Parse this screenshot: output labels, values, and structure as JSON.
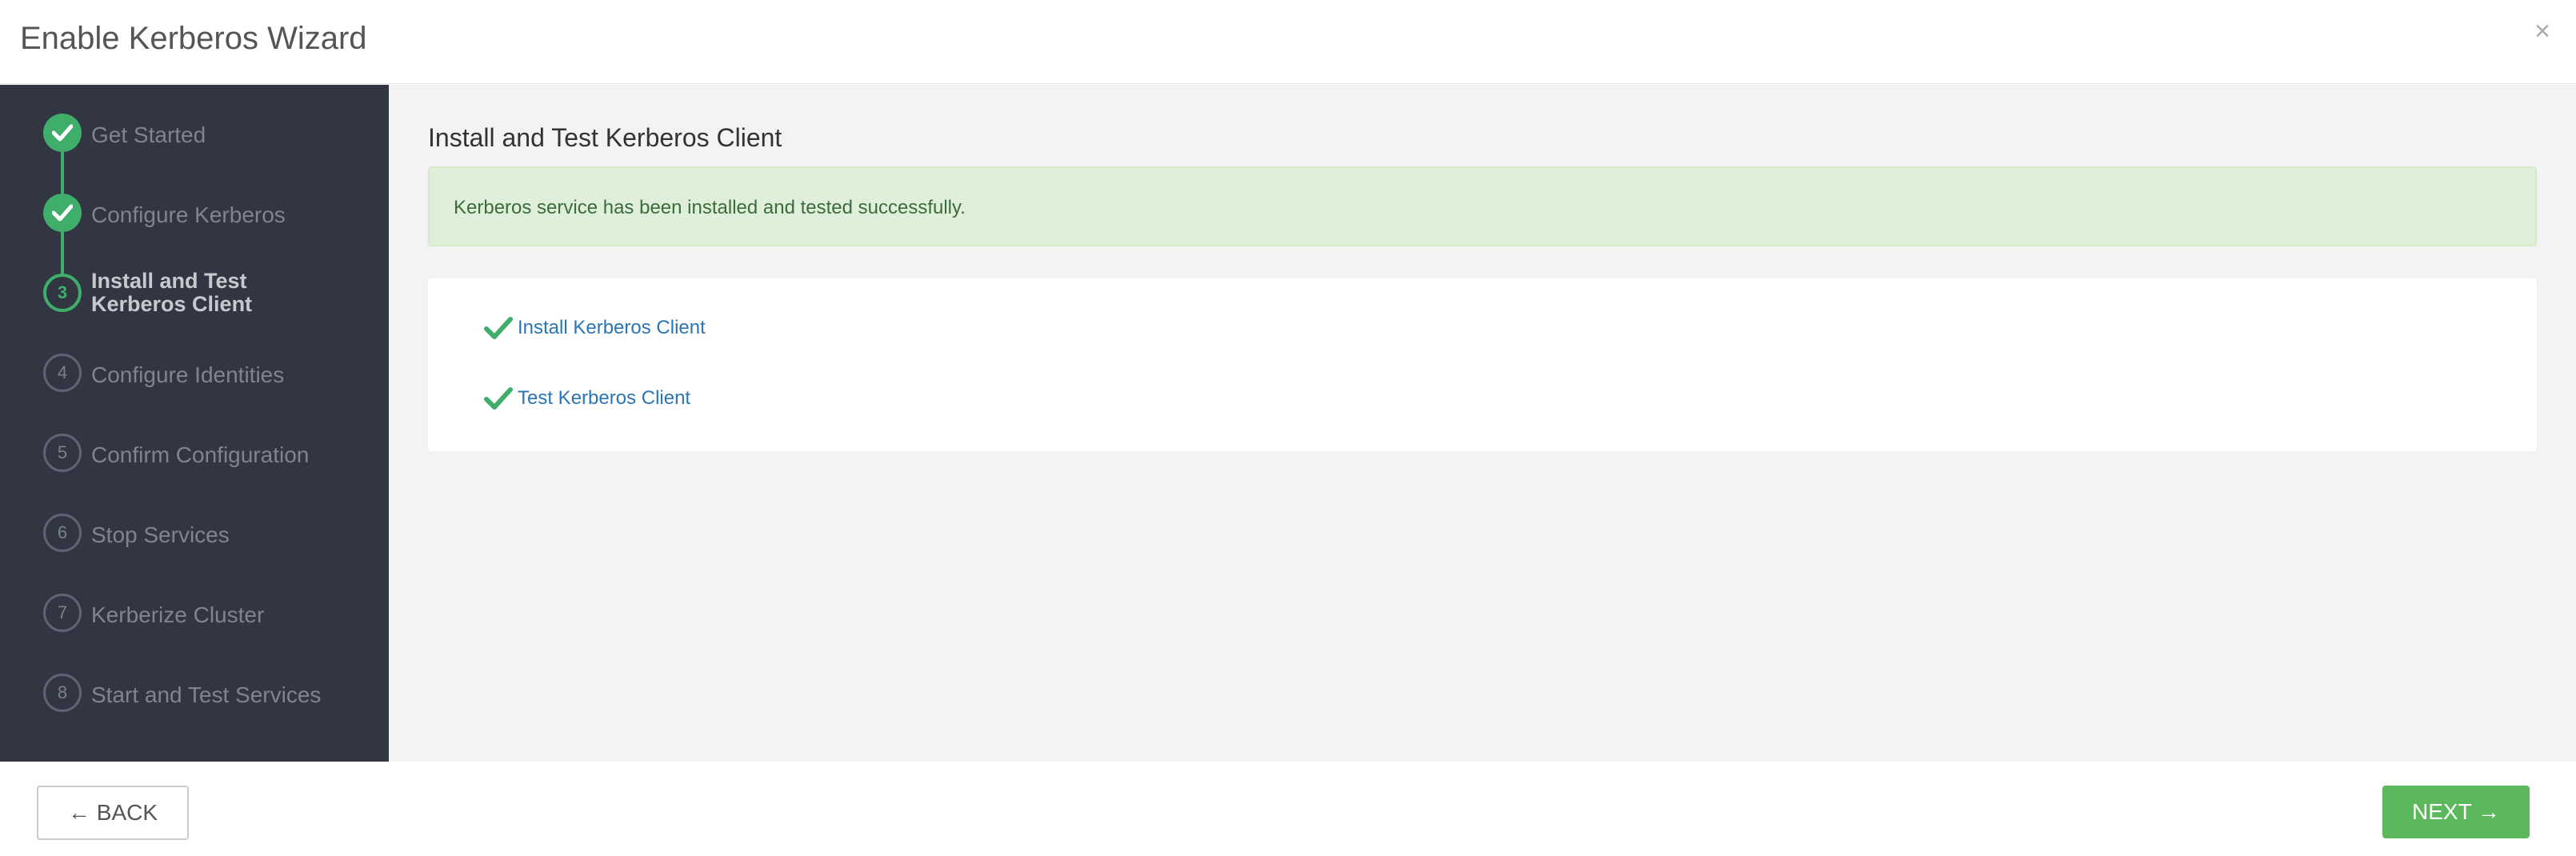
{
  "header": {
    "title": "Enable Kerberos Wizard",
    "close_label": "×"
  },
  "sidebar": {
    "steps": [
      {
        "number": "1",
        "label": "Get Started",
        "state": "done"
      },
      {
        "number": "2",
        "label": "Configure Kerberos",
        "state": "done"
      },
      {
        "number": "3",
        "label_line1": "Install and Test",
        "label_line2": "Kerberos Client",
        "state": "current"
      },
      {
        "number": "4",
        "label": "Configure Identities",
        "state": "todo"
      },
      {
        "number": "5",
        "label": "Confirm Configuration",
        "state": "todo"
      },
      {
        "number": "6",
        "label": "Stop Services",
        "state": "todo"
      },
      {
        "number": "7",
        "label": "Kerberize Cluster",
        "state": "todo"
      },
      {
        "number": "8",
        "label": "Start and Test Services",
        "state": "todo"
      }
    ]
  },
  "main": {
    "title": "Install and Test Kerberos Client",
    "alert": "Kerberos service has been installed and tested successfully.",
    "tasks": [
      {
        "label": "Install Kerberos Client",
        "status": "completed",
        "icon": "check-icon"
      },
      {
        "label": "Test Kerberos Client",
        "status": "completed",
        "icon": "check-icon"
      }
    ]
  },
  "footer": {
    "back_label": "← BACK",
    "next_label": "NEXT →"
  },
  "colors": {
    "accent_green": "#3fae6a",
    "sidebar_bg": "#323643",
    "link_blue": "#2a75b5",
    "next_button": "#5cb85c"
  }
}
